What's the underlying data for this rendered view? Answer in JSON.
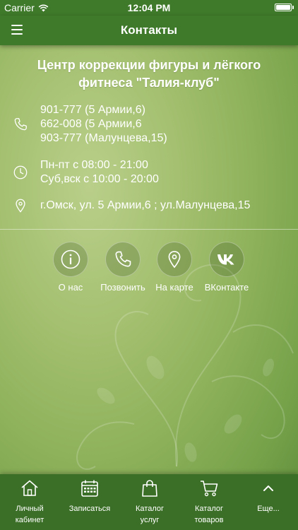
{
  "status": {
    "carrier": "Carrier",
    "time": "12:04 PM",
    "battery_level": 1.0
  },
  "nav": {
    "title": "Контакты",
    "menu_icon": "hamburger-menu-icon"
  },
  "org": {
    "name": "Центр коррекции фигуры и лёгкого фитнеса \"Талия-клуб\""
  },
  "contacts": {
    "phones": [
      "901-777 (5 Армии,6)",
      "662-008 (5 Армии,6",
      "903-777 (Малунцева,15)"
    ],
    "hours": [
      "Пн-пт с 08:00 - 21:00",
      "Суб,вск с 10:00 - 20:00"
    ],
    "address": "г.Омск, ул. 5 Армии,6 ; ул.Малунцева,15"
  },
  "actions": [
    {
      "label": "О нас",
      "icon": "info-icon"
    },
    {
      "label": "Позвонить",
      "icon": "phone-icon"
    },
    {
      "label": "На карте",
      "icon": "map-pin-icon"
    },
    {
      "label": "ВКонтакте",
      "icon": "vk-icon"
    }
  ],
  "tabs": [
    {
      "label": "Личный\nкабинет",
      "icon": "home-icon"
    },
    {
      "label": "Записаться",
      "icon": "calendar-icon"
    },
    {
      "label": "Каталог\nуслуг",
      "icon": "shopping-bag-icon"
    },
    {
      "label": "Каталог\nтоваров",
      "icon": "shopping-cart-icon"
    },
    {
      "label": "Еще...",
      "icon": "chevron-up-icon"
    }
  ],
  "colors": {
    "header": "#3f7a2a",
    "tab_bar": "#3b6f27",
    "background": "#9dbd68"
  }
}
